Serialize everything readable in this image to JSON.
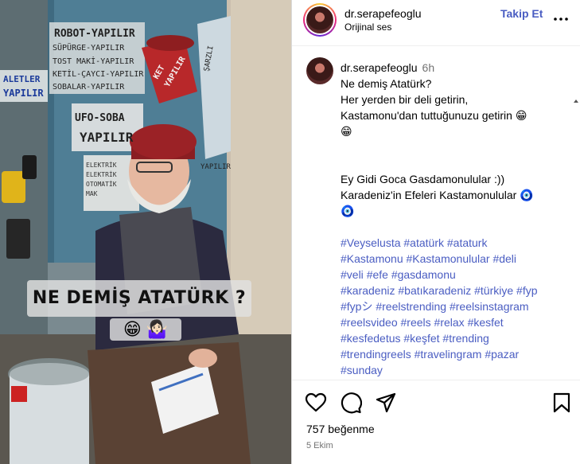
{
  "post": {
    "username": "dr.serapefeoglu",
    "audio": "Orijinal ses",
    "follow_label": "Takip Et",
    "more_icon": "more-horizontal-icon"
  },
  "media": {
    "overlay_text": "NE DEMİŞ ATATÜRK ?",
    "overlay_emoji_1": "😁",
    "overlay_emoji_2": "🤷🏻‍♀️",
    "signs": {
      "robot": "ROBOT-YAPILIR",
      "sup": "SÜPÜRGE-YAPILIR",
      "tost": "TOST MAKİ-YAPILIR",
      "ketil": "KETİL-ÇAYCI-YAPILIR",
      "sobalar": "SOBALAR-YAPILIR",
      "ufo": "UFO-SOBA",
      "yapilir": "YAPILIR",
      "aleteler": "ALETLER",
      "yapilir_left": "YAPILIR",
      "elektrik": "ELEKTRİK",
      "elektrik2": "ELEKTRİK",
      "otomatik": "OTOMATİK",
      "mak": "MAK",
      "kettle": "YAPILIR",
      "sarzli": "ŞARZLI",
      "kettle2": "KET",
      "kettle3": "YAPILIR"
    }
  },
  "comment": {
    "username": "dr.serapefeoglu",
    "time": "6h",
    "lines": [
      "Ne demiş Atatürk?",
      "Her yerden bir deli getirin,",
      "Kastamonu'dan tuttuğunuzu getirin 😁",
      "😁",
      "",
      "Ey Gidi Goca Gasdamonulular :))",
      "Karadeniz'in Efeleri Kastamonulular 🧿",
      "🧿"
    ],
    "hashtag_lines": [
      [
        "#Veyselusta",
        "#atatürk",
        "#ataturk"
      ],
      [
        "#Kastamonu",
        "#Kastamonulular",
        "#deli"
      ],
      [
        "#veli",
        "#efe",
        "#gasdamonu"
      ],
      [
        "#karadeniz",
        "#batıkaradeniz",
        "#türkiye",
        "#fyp"
      ],
      [
        "#fypシ",
        "#reelstrending",
        "#reelsinstagram"
      ],
      [
        "#reelsvideo",
        "#reels",
        "#relax",
        "#kesfet"
      ],
      [
        "#kesfedetus",
        "#keşfet",
        "#trending"
      ],
      [
        "#trendingreels",
        "#travelingram",
        "#pazar"
      ],
      [
        "#sunday"
      ]
    ]
  },
  "actions": {
    "like_icon": "heart-icon",
    "comment_icon": "comment-icon",
    "share_icon": "share-icon",
    "save_icon": "bookmark-icon"
  },
  "likes": "757 beğenme",
  "date": "5 Ekim",
  "colors": {
    "link": "#4a5dc2",
    "muted": "#737373",
    "border": "#dbdbdb"
  }
}
